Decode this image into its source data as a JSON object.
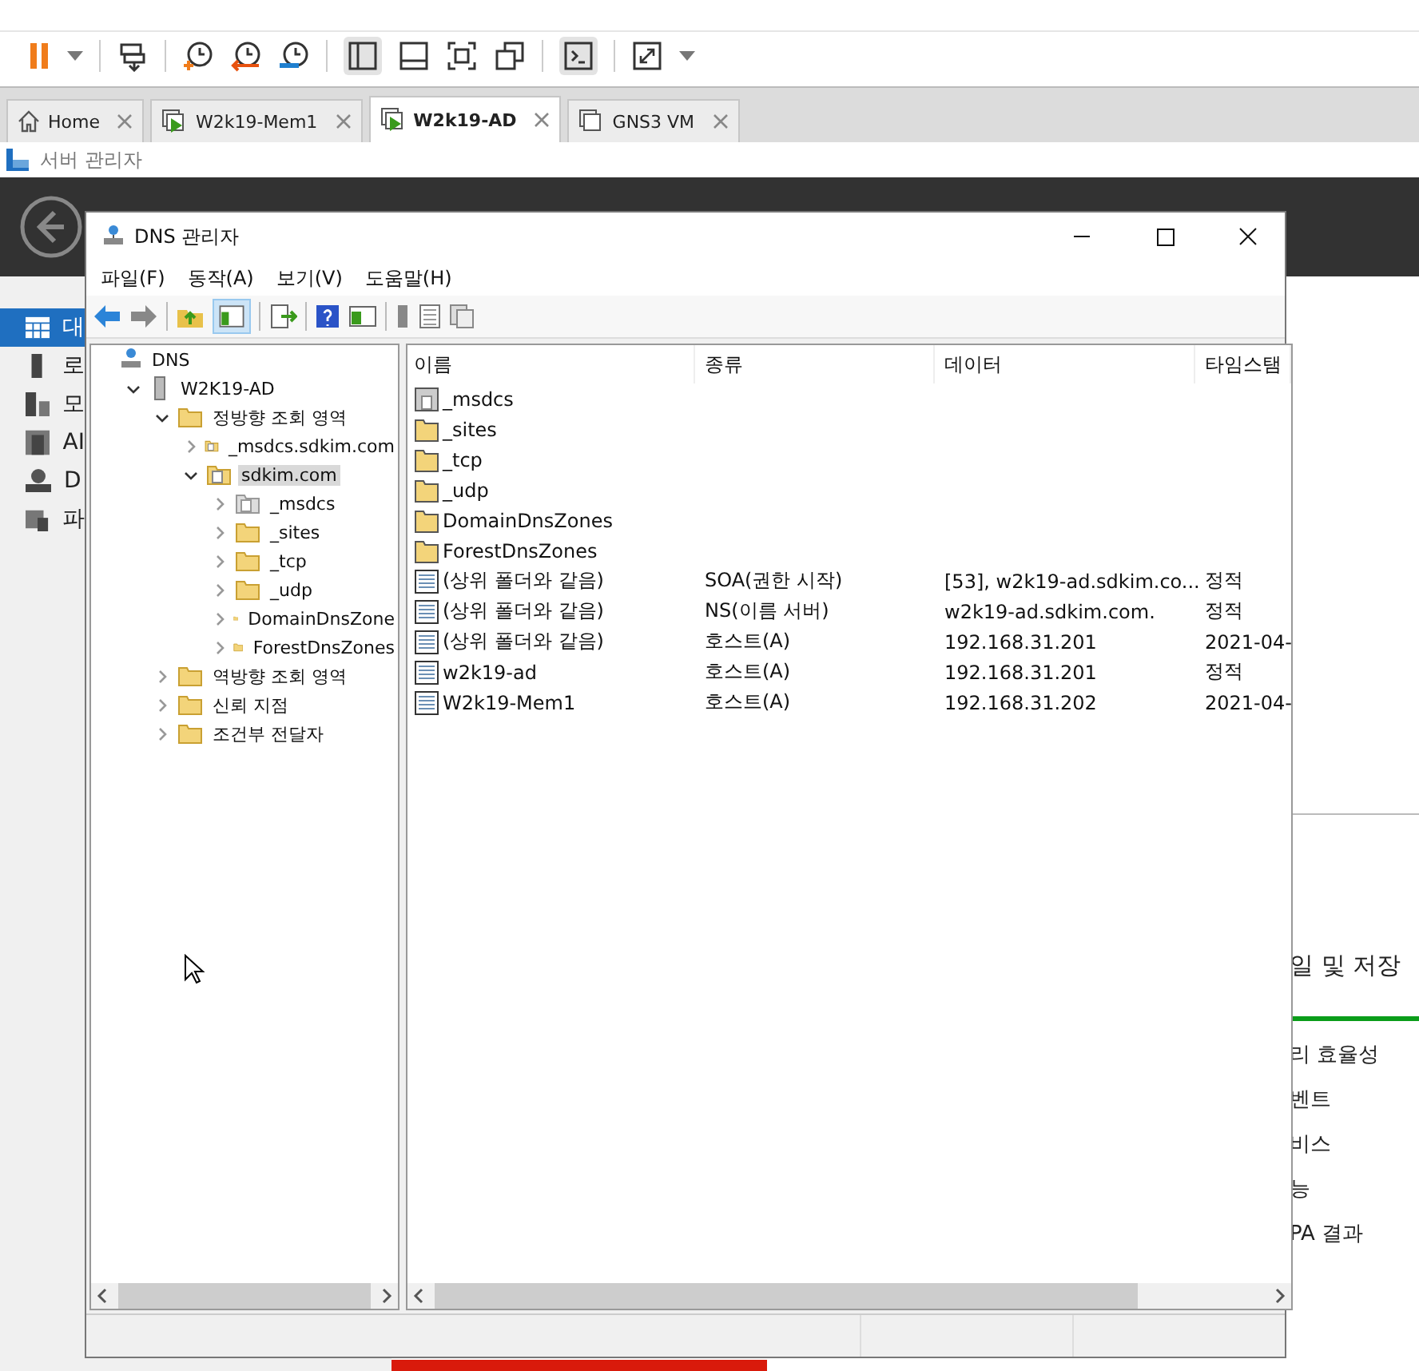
{
  "vm_tabs": [
    {
      "label": "Home",
      "kind": "home",
      "selected": false
    },
    {
      "label": "W2k19-Mem1",
      "kind": "vm-running",
      "selected": false
    },
    {
      "label": "W2k19-AD",
      "kind": "vm-running",
      "selected": true
    },
    {
      "label": "GNS3 VM",
      "kind": "vm",
      "selected": false
    }
  ],
  "app_title": "서버 관리자",
  "server_manager": {
    "nav": [
      {
        "label": "대",
        "kind": "dashboard",
        "selected": true
      },
      {
        "label": "로",
        "kind": "local",
        "selected": false
      },
      {
        "label": "모",
        "kind": "all",
        "selected": false
      },
      {
        "label": "AI",
        "kind": "ad",
        "selected": false
      },
      {
        "label": "D",
        "kind": "dns",
        "selected": false
      },
      {
        "label": "파",
        "kind": "files",
        "selected": false
      }
    ],
    "tile_title": "일 및 저장",
    "tile_items": [
      "리 효율성",
      "벤트",
      "비스",
      "능",
      "PA 결과"
    ]
  },
  "dns_window": {
    "title": "DNS 관리자",
    "menu": [
      "파일(F)",
      "동작(A)",
      "보기(V)",
      "도움말(H)"
    ],
    "tree": [
      {
        "label": "DNS",
        "kind": "dns",
        "selected": false,
        "children": [
          {
            "label": "W2K19-AD",
            "kind": "server",
            "expanded": true,
            "selected": false,
            "children": [
              {
                "label": "정방향 조회 영역",
                "kind": "folder",
                "expanded": true,
                "selected": false,
                "children": [
                  {
                    "label": "_msdcs.sdkim.com",
                    "kind": "zone",
                    "expanded": false,
                    "selected": false
                  },
                  {
                    "label": "sdkim.com",
                    "kind": "zone",
                    "expanded": true,
                    "selected": true,
                    "children": [
                      {
                        "label": "_msdcs",
                        "kind": "delegated",
                        "expanded": false,
                        "selected": false
                      },
                      {
                        "label": "_sites",
                        "kind": "folder",
                        "expanded": false,
                        "selected": false
                      },
                      {
                        "label": "_tcp",
                        "kind": "folder",
                        "expanded": false,
                        "selected": false
                      },
                      {
                        "label": "_udp",
                        "kind": "folder",
                        "expanded": false,
                        "selected": false
                      },
                      {
                        "label": "DomainDnsZone",
                        "kind": "folder",
                        "expanded": false,
                        "selected": false
                      },
                      {
                        "label": "ForestDnsZones",
                        "kind": "folder",
                        "expanded": false,
                        "selected": false
                      }
                    ]
                  }
                ]
              },
              {
                "label": "역방향 조회 영역",
                "kind": "folder",
                "expanded": false,
                "selected": false
              },
              {
                "label": "신뢰 지점",
                "kind": "folder",
                "expanded": false,
                "selected": false
              },
              {
                "label": "조건부 전달자",
                "kind": "folder",
                "expanded": false,
                "selected": false
              }
            ]
          }
        ]
      }
    ],
    "columns": [
      "이름",
      "종류",
      "데이터",
      "타임스탬"
    ],
    "rows": [
      {
        "kind": "delegated",
        "name": "_msdcs"
      },
      {
        "kind": "folder",
        "name": "_sites"
      },
      {
        "kind": "folder",
        "name": "_tcp"
      },
      {
        "kind": "folder",
        "name": "_udp"
      },
      {
        "kind": "folder",
        "name": "DomainDnsZones"
      },
      {
        "kind": "folder",
        "name": "ForestDnsZones"
      },
      {
        "kind": "record",
        "name": "(상위 폴더와 같음)",
        "type": "SOA(권한 시작)",
        "data": "[53], w2k19-ad.sdkim.co...",
        "column_4": "정적"
      },
      {
        "kind": "record",
        "name": "(상위 폴더와 같음)",
        "type": "NS(이름 서버)",
        "data": "w2k19-ad.sdkim.com.",
        "column_4": "정적"
      },
      {
        "kind": "record",
        "name": "(상위 폴더와 같음)",
        "type": "호스트(A)",
        "data": "192.168.31.201",
        "column_4": "2021-04-"
      },
      {
        "kind": "record",
        "name": "w2k19-ad",
        "type": "호스트(A)",
        "data": "192.168.31.201",
        "column_4": "정적"
      },
      {
        "kind": "record",
        "name": "W2k19-Mem1",
        "type": "호스트(A)",
        "data": "192.168.31.202",
        "column_4": "2021-04-"
      }
    ]
  }
}
